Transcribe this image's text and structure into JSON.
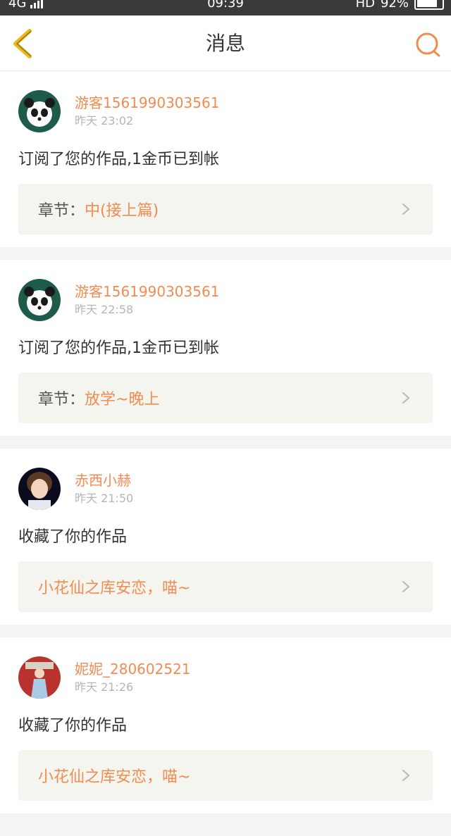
{
  "status_bar": {
    "network": "4G",
    "time": "09:39",
    "hd": "HD",
    "battery": "92%"
  },
  "header": {
    "title": "消息"
  },
  "messages": [
    {
      "username": "游客1561990303561",
      "time": "昨天 23:02",
      "action": "订阅了您的作品,1金币已到帐",
      "link_label": "章节：",
      "link_value": "中(接上篇)"
    },
    {
      "username": "游客1561990303561",
      "time": "昨天 22:58",
      "action": "订阅了您的作品,1金币已到帐",
      "link_label": "章节：",
      "link_value": "放学~晚上"
    },
    {
      "username": "赤西小赫",
      "time": "昨天 21:50",
      "action": "收藏了你的作品",
      "link_label": "",
      "link_value": "小花仙之库安恋，喵~"
    },
    {
      "username": "妮妮_280602521",
      "time": "昨天 21:26",
      "action": "收藏了你的作品",
      "link_label": "",
      "link_value": "小花仙之库安恋，喵~"
    }
  ],
  "colors": {
    "accent": "#f08c52",
    "back_icon": "#e8b920",
    "link_bg": "#f5f5ef"
  }
}
